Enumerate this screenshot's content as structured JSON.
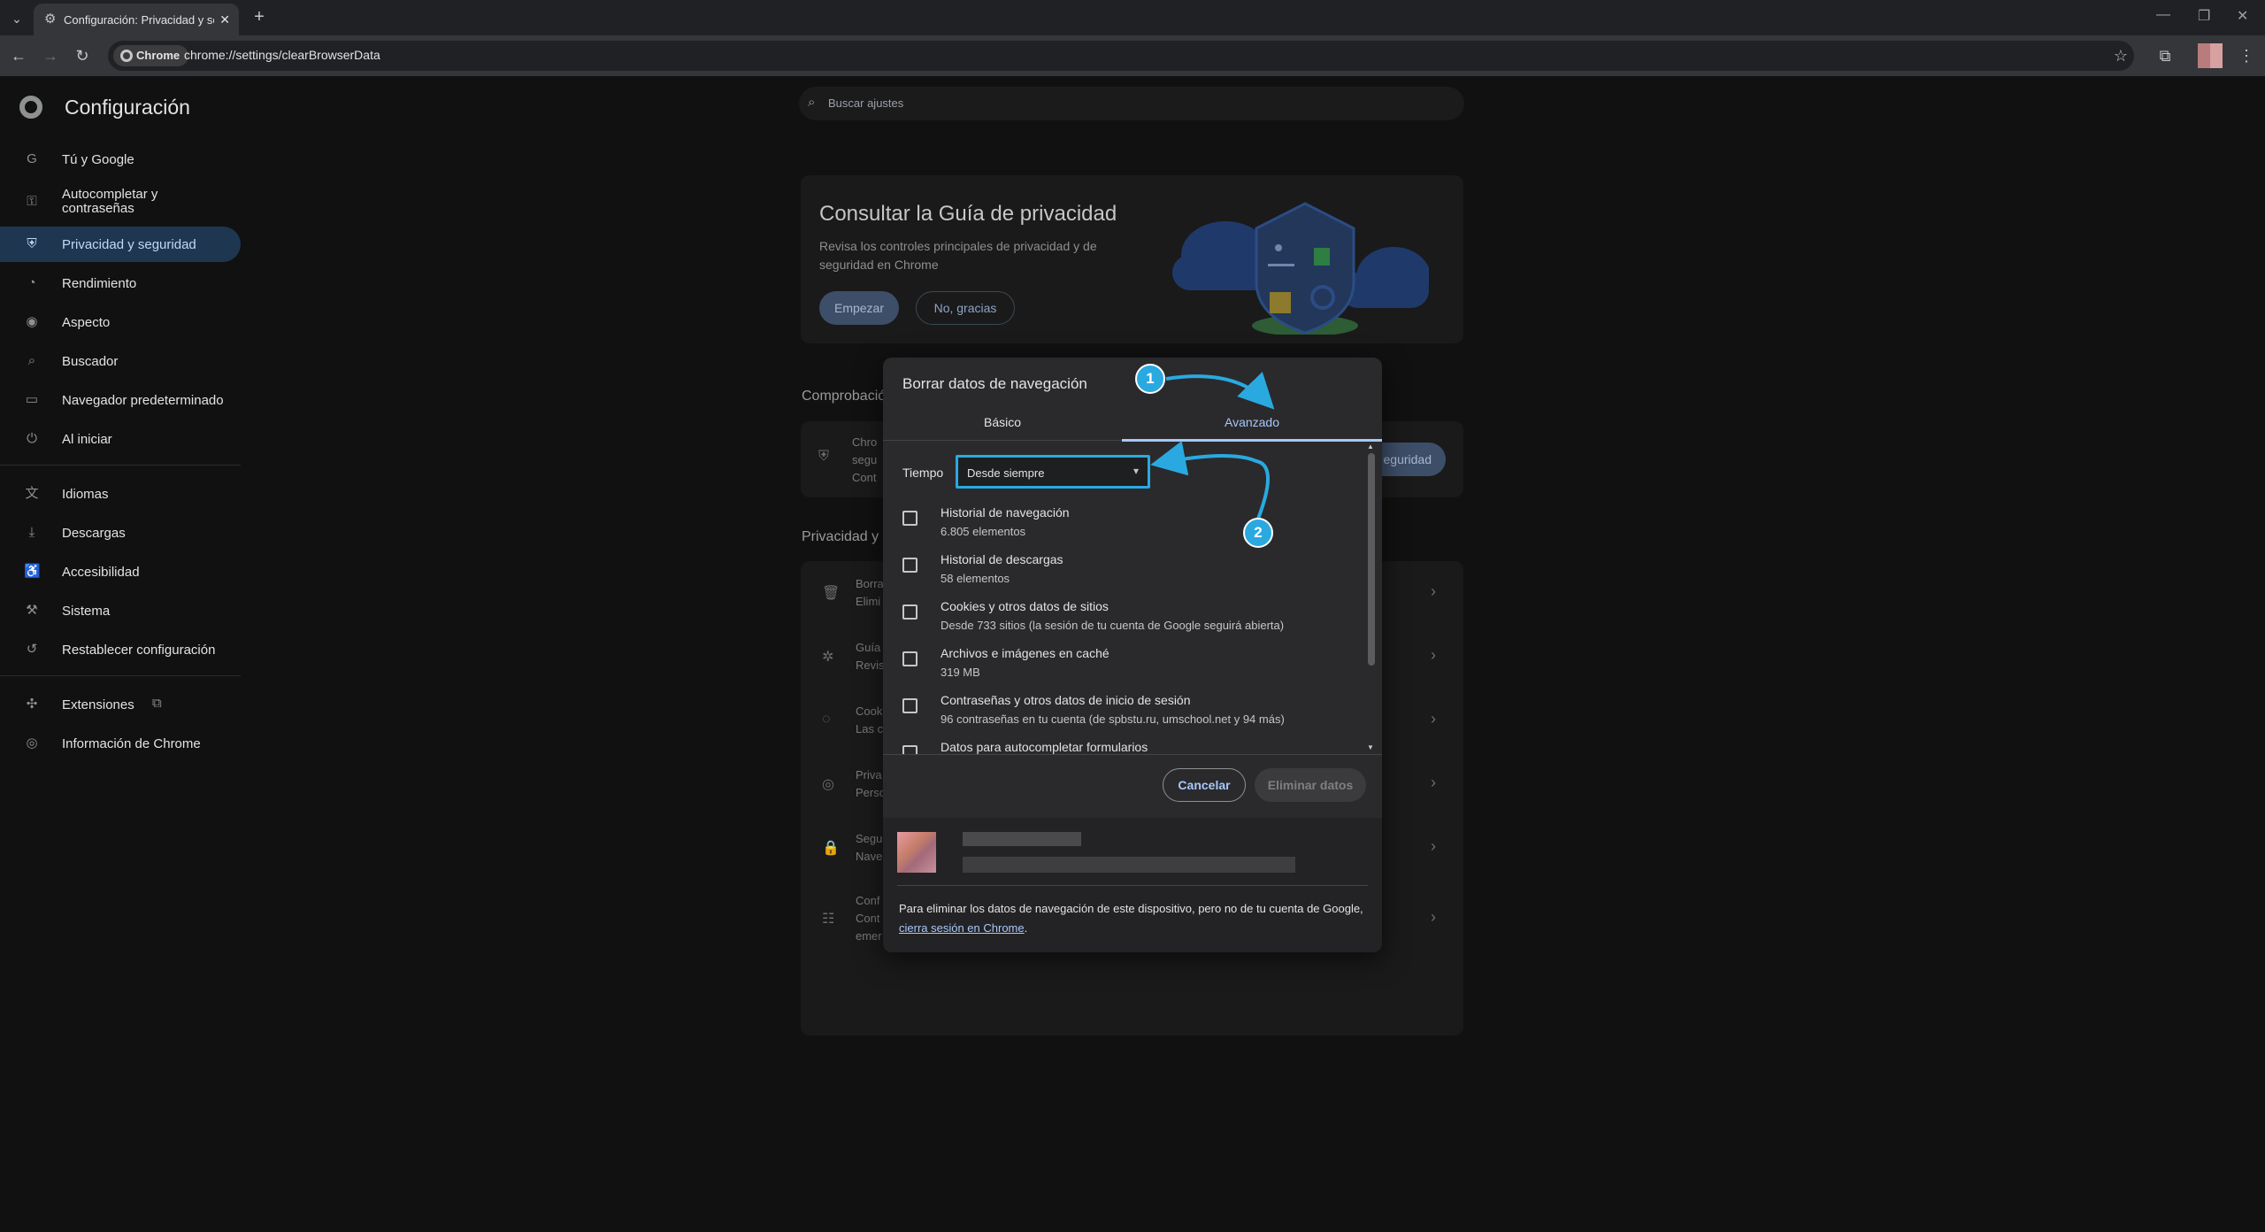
{
  "browser": {
    "tab_title": "Configuración: Privacidad y seg",
    "url_chip": "Chrome",
    "url": "chrome://settings/clearBrowserData",
    "icons": [
      "tab-search-icon",
      "settings-gear-icon",
      "close-icon",
      "new-tab-icon",
      "back-icon",
      "forward-icon",
      "reload-icon",
      "star-icon",
      "extensions-icon",
      "menu-icon"
    ]
  },
  "settings": {
    "brand": "Configuración",
    "search_placeholder": "Buscar ajustes",
    "nav": [
      {
        "label": "Tú y Google",
        "icon": "google-icon"
      },
      {
        "label": "Autocompletar y contraseñas",
        "icon": "key-icon"
      },
      {
        "label": "Privacidad y seguridad",
        "icon": "shield-icon"
      },
      {
        "label": "Rendimiento",
        "icon": "gauge-icon"
      },
      {
        "label": "Aspecto",
        "icon": "palette-icon"
      },
      {
        "label": "Buscador",
        "icon": "search-icon"
      },
      {
        "label": "Navegador predeterminado",
        "icon": "browser-icon"
      },
      {
        "label": "Al iniciar",
        "icon": "power-icon"
      },
      {
        "label": "Idiomas",
        "icon": "translate-icon"
      },
      {
        "label": "Descargas",
        "icon": "download-icon"
      },
      {
        "label": "Accesibilidad",
        "icon": "accessibility-icon"
      },
      {
        "label": "Sistema",
        "icon": "wrench-icon"
      },
      {
        "label": "Restablecer configuración",
        "icon": "reset-icon"
      },
      {
        "label": "Extensiones",
        "icon": "puzzle-icon"
      },
      {
        "label": "Información de Chrome",
        "icon": "chrome-icon"
      }
    ],
    "guide": {
      "title": "Consultar la Guía de privacidad",
      "desc": "Revisa los controles principales de privacidad y de seguridad en Chrome",
      "start": "Empezar",
      "no": "No, gracias"
    },
    "section_check": "Comprobación de seguridad",
    "section_check_visible": "Comprobació",
    "check_row_lines": [
      "Chro",
      "segu",
      "Cont"
    ],
    "check_button": "eguridad",
    "section_privacy_visible": "Privacidad y s",
    "rows": [
      [
        "Borra",
        "Elimi"
      ],
      [
        "Guía",
        "Revis"
      ],
      [
        "Cook",
        "Las c"
      ],
      [
        "Priva",
        "Perso"
      ],
      [
        "Segu",
        "Nave"
      ],
      [
        "Conf",
        "Cont",
        "emer"
      ]
    ]
  },
  "dialog": {
    "title": "Borrar datos de navegación",
    "tab_basic": "Básico",
    "tab_advanced": "Avanzado",
    "time_label": "Tiempo",
    "time_value": "Desde siempre",
    "items": [
      {
        "title": "Historial de navegación",
        "sub": "6.805 elementos"
      },
      {
        "title": "Historial de descargas",
        "sub": "58 elementos"
      },
      {
        "title": "Cookies y otros datos de sitios",
        "sub": "Desde 733 sitios (la sesión de tu cuenta de Google seguirá abierta)"
      },
      {
        "title": "Archivos e imágenes en caché",
        "sub": "319 MB"
      },
      {
        "title": "Contraseñas y otros datos de inicio de sesión",
        "sub": "96 contraseñas en tu cuenta (de spbstu.ru, umschool.net y 94 más)"
      },
      {
        "title": "Datos para autocompletar formularios",
        "sub": ""
      }
    ],
    "cancel": "Cancelar",
    "delete": "Eliminar datos",
    "footer_text": "Para eliminar los datos de navegación de este dispositivo, pero no de tu cuenta de Google, ",
    "footer_link": "cierra sesión en Chrome",
    "footer_end": "."
  },
  "annotations": {
    "badge1": "1",
    "badge2": "2",
    "color": "#2aa9e0"
  }
}
